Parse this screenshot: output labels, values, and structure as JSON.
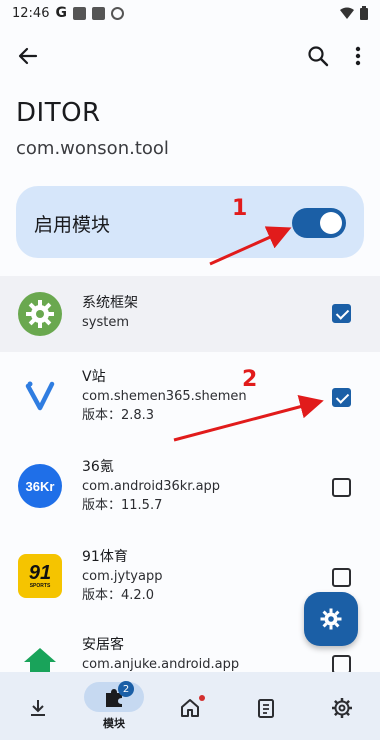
{
  "status_bar": {
    "time": "12:46",
    "google_letter": "G"
  },
  "toolbar": {
    "back": "back-icon",
    "search": "search-icon",
    "more": "more-vert-icon"
  },
  "app": {
    "title": "DITOR",
    "package": "com.wonson.tool"
  },
  "enable_card": {
    "label": "启用模块",
    "enabled": true
  },
  "annotations": {
    "one": "1",
    "two": "2"
  },
  "modules": [
    {
      "name": "系统框架",
      "package": "system",
      "version": "",
      "checked": true,
      "icon": "gear-icon"
    },
    {
      "name": "V站",
      "package": "com.shemen365.shemen",
      "version": "版本：2.8.3",
      "checked": true,
      "icon": "v-logo-icon"
    },
    {
      "name": "36氪",
      "package": "com.android36kr.app",
      "version": "版本：11.5.7",
      "checked": false,
      "icon": "36kr-logo-icon",
      "icon_text": "36Kr"
    },
    {
      "name": "91体育",
      "package": "com.jytyapp",
      "version": "版本：4.2.0",
      "checked": false,
      "icon": "91-sports-logo-icon",
      "icon_text": "91",
      "icon_subtext": "SPORTS"
    },
    {
      "name": "安居客",
      "package": "com.anjuke.android.app",
      "version": "",
      "checked": false,
      "icon": "home-logo-icon"
    }
  ],
  "bottom_nav": {
    "items": [
      {
        "id": "download",
        "icon": "download-icon",
        "label": ""
      },
      {
        "id": "modules",
        "icon": "puzzle-icon",
        "label": "模块",
        "badge": "2"
      },
      {
        "id": "home",
        "icon": "home-icon",
        "label": ""
      },
      {
        "id": "logs",
        "icon": "clipboard-icon",
        "label": ""
      },
      {
        "id": "settings",
        "icon": "settings-icon",
        "label": ""
      }
    ]
  },
  "colors": {
    "accent": "#1b5fa6",
    "card": "#d6e6fa",
    "annotation": "#e11b1b",
    "nav_bg": "#e8eef7"
  }
}
